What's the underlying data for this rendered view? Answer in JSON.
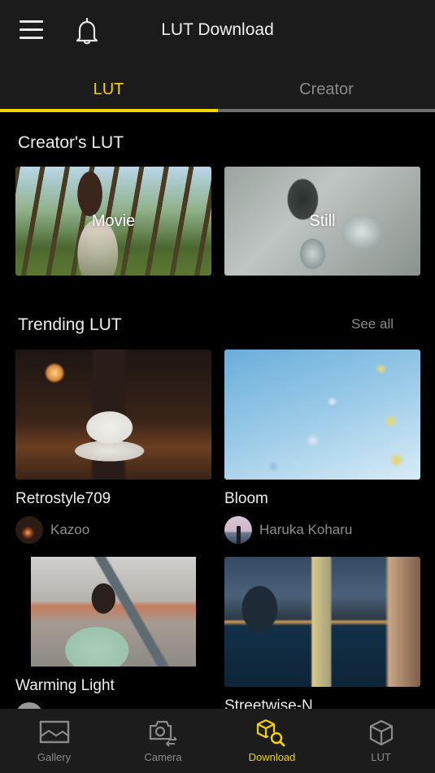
{
  "header": {
    "title": "LUT Download",
    "menu_icon": "hamburger-menu-icon",
    "notification_icon": "bell-icon"
  },
  "tabs": [
    {
      "label": "LUT",
      "active": true
    },
    {
      "label": "Creator",
      "active": false
    }
  ],
  "creators_lut": {
    "title": "Creator's LUT",
    "cards": [
      {
        "label": "Movie"
      },
      {
        "label": "Still"
      }
    ]
  },
  "trending": {
    "title": "Trending LUT",
    "see_all": "See all",
    "items": [
      {
        "title": "Retrostyle709",
        "author": "Kazoo"
      },
      {
        "title": "Bloom",
        "author": "Haruka Koharu"
      },
      {
        "title": "Warming Light",
        "author": ""
      },
      {
        "title": "Streetwise-N",
        "author": ""
      }
    ]
  },
  "bottom_nav": [
    {
      "label": "Gallery",
      "icon": "gallery-icon",
      "active": false
    },
    {
      "label": "Camera",
      "icon": "camera-switch-icon",
      "active": false
    },
    {
      "label": "Download",
      "icon": "lut-search-icon",
      "active": true
    },
    {
      "label": "LUT",
      "icon": "cube-icon",
      "active": false
    }
  ],
  "colors": {
    "accent": "#f5d300",
    "background": "#000000",
    "bar_background": "#1b1b1b",
    "inactive_text": "#8a8a8a"
  }
}
